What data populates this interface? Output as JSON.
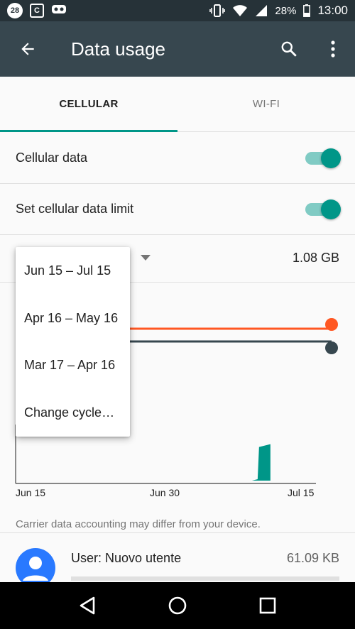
{
  "status_bar": {
    "badge1": "28",
    "badge2": "C",
    "battery": "28%",
    "time": "13:00",
    "icons": [
      "notification-28-icon",
      "cyanogen-icon",
      "game-controller-icon",
      "vibrate-icon",
      "wifi-icon",
      "signal-icon",
      "battery-icon"
    ]
  },
  "app_bar": {
    "title": "Data usage",
    "back_icon": "arrow-back-icon",
    "search_icon": "search-icon",
    "more_icon": "more-vert-icon"
  },
  "tabs": [
    {
      "label": "CELLULAR",
      "active": true
    },
    {
      "label": "WI-FI",
      "active": false
    }
  ],
  "settings": {
    "cellular_data": {
      "label": "Cellular data",
      "enabled": true
    },
    "data_limit": {
      "label": "Set cellular data limit",
      "enabled": true
    }
  },
  "cycle": {
    "total": "1.08 GB"
  },
  "chart_data": {
    "type": "area",
    "x_tick_labels": [
      "Jun 15",
      "Jun 30",
      "Jul 15"
    ],
    "limit_line_color": "#ff5722",
    "warning_line_color": "#37474f",
    "usage_color": "#009688",
    "usage_spike_day_fraction": 0.82,
    "usage_spike_height_fraction": 0.92
  },
  "carrier_note": "Carrier data accounting may differ from your device.",
  "user": {
    "name": "User: Nuovo utente",
    "usage": "61.09 KB"
  },
  "popup_menu": {
    "items": [
      "Jun 15 – Jul 15",
      "Apr 16 – May 16",
      "Mar 17 – Apr 16",
      "Change cycle…"
    ]
  },
  "nav_bar": {
    "back": "nav-back-icon",
    "home": "nav-home-icon",
    "recents": "nav-recents-icon"
  },
  "colors": {
    "status_bar": "#263238",
    "app_bar": "#37474f",
    "accent": "#009688",
    "limit": "#ff5722"
  }
}
